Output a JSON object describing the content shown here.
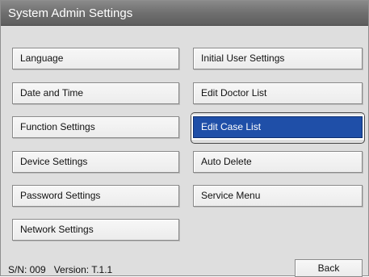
{
  "window": {
    "title": "System Admin Settings"
  },
  "left_column": {
    "items": [
      {
        "label": "Language"
      },
      {
        "label": "Date and Time"
      },
      {
        "label": "Function Settings"
      },
      {
        "label": "Device Settings"
      },
      {
        "label": "Password Settings"
      },
      {
        "label": "Network Settings"
      }
    ]
  },
  "right_column": {
    "items": [
      {
        "label": "Initial User Settings"
      },
      {
        "label": "Edit Doctor List"
      },
      {
        "label": "Edit Case List",
        "selected": true
      },
      {
        "label": "Auto Delete"
      },
      {
        "label": "Service Menu"
      }
    ]
  },
  "footer": {
    "serial_label": "S/N: 009",
    "version_label": "Version: T.1.1",
    "back_label": "Back"
  },
  "colors": {
    "selected_button": "#1f4fa8",
    "title_bar": "#6f6f6f",
    "panel_background": "#dedede"
  }
}
